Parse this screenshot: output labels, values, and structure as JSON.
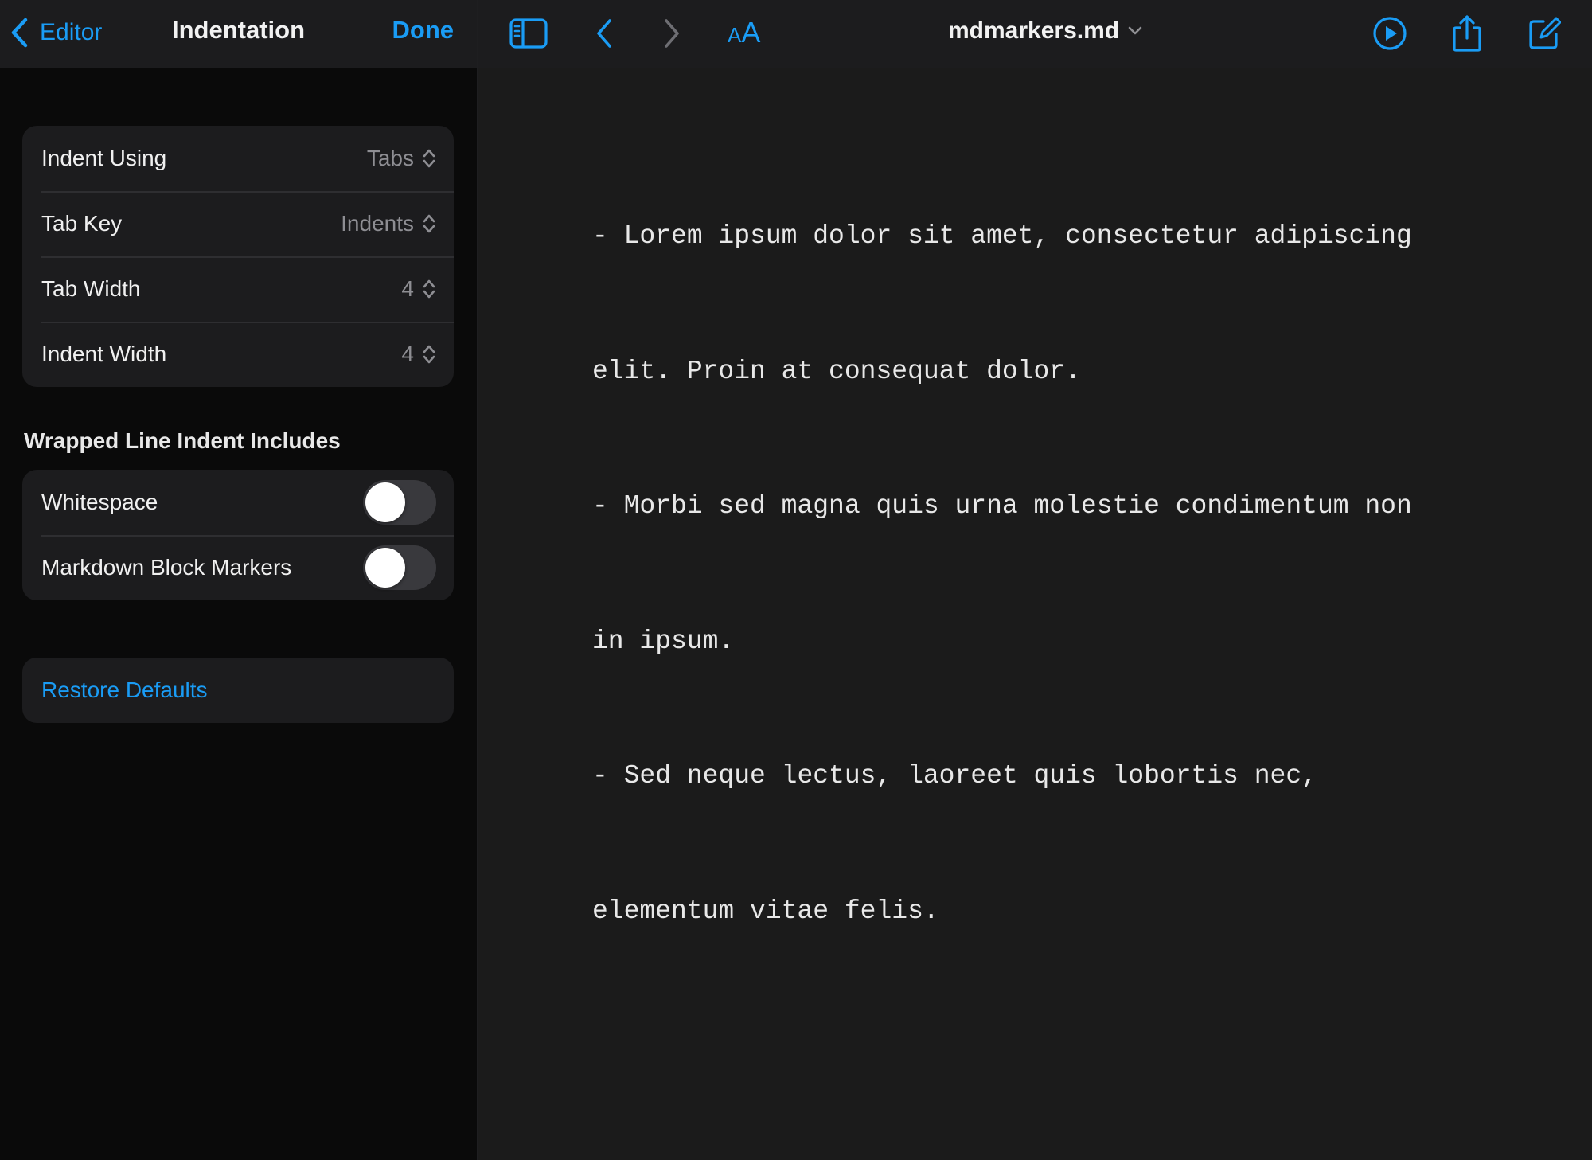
{
  "sidebar": {
    "nav": {
      "back_label": "Editor",
      "title": "Indentation",
      "done_label": "Done"
    },
    "indent_settings": [
      {
        "label": "Indent Using",
        "value": "Tabs"
      },
      {
        "label": "Tab Key",
        "value": "Indents"
      },
      {
        "label": "Tab Width",
        "value": "4"
      },
      {
        "label": "Indent Width",
        "value": "4"
      }
    ],
    "wrapped_section": {
      "header": "Wrapped Line Indent Includes",
      "toggles": [
        {
          "label": "Whitespace",
          "on": false
        },
        {
          "label": "Markdown Block Markers",
          "on": false
        }
      ]
    },
    "restore_label": "Restore Defaults"
  },
  "toolbar": {
    "icons": [
      "sidebar-toggle-icon",
      "back-chevron-icon",
      "forward-chevron-icon",
      "text-size-icon",
      "play-icon",
      "share-icon",
      "compose-icon"
    ],
    "font_small": "A",
    "font_big": "A",
    "file_name": "mdmarkers.md"
  },
  "document": {
    "lines": [
      "- Lorem ipsum dolor sit amet, consectetur adipiscing",
      "elit. Proin at consequat dolor.",
      "- Morbi sed magna quis urna molestie condimentum non",
      "in ipsum.",
      "- Sed neque lectus, laoreet quis lobortis nec,",
      "elementum vitae felis."
    ]
  },
  "colors": {
    "accent": "#1a9cf5",
    "sidebar_bg": "#0a0a0a",
    "group_bg": "#1c1c1e",
    "editor_bg": "#1b1b1b",
    "secondary_text": "#8e8e93"
  }
}
